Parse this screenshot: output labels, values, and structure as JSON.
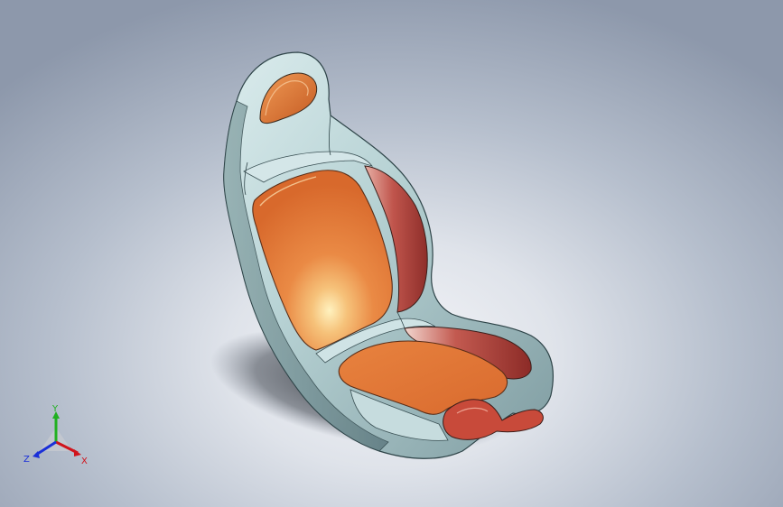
{
  "view": {
    "model": "bucket-seat-part",
    "colors": {
      "shell": "#b9d2d4",
      "shell_shadow": "#7e9a9f",
      "cushion": "#e6803e",
      "cushion_highlight": "#fde7a6",
      "side_bolster": "#b84a42",
      "background_center": "#f4f5f8",
      "background_edge": "#8d98ab"
    }
  },
  "triad": {
    "x_label": "X",
    "y_label": "Y",
    "z_label": "Z",
    "x_color": "#d0141c",
    "y_color": "#20b020",
    "z_color": "#1a2fd8"
  }
}
